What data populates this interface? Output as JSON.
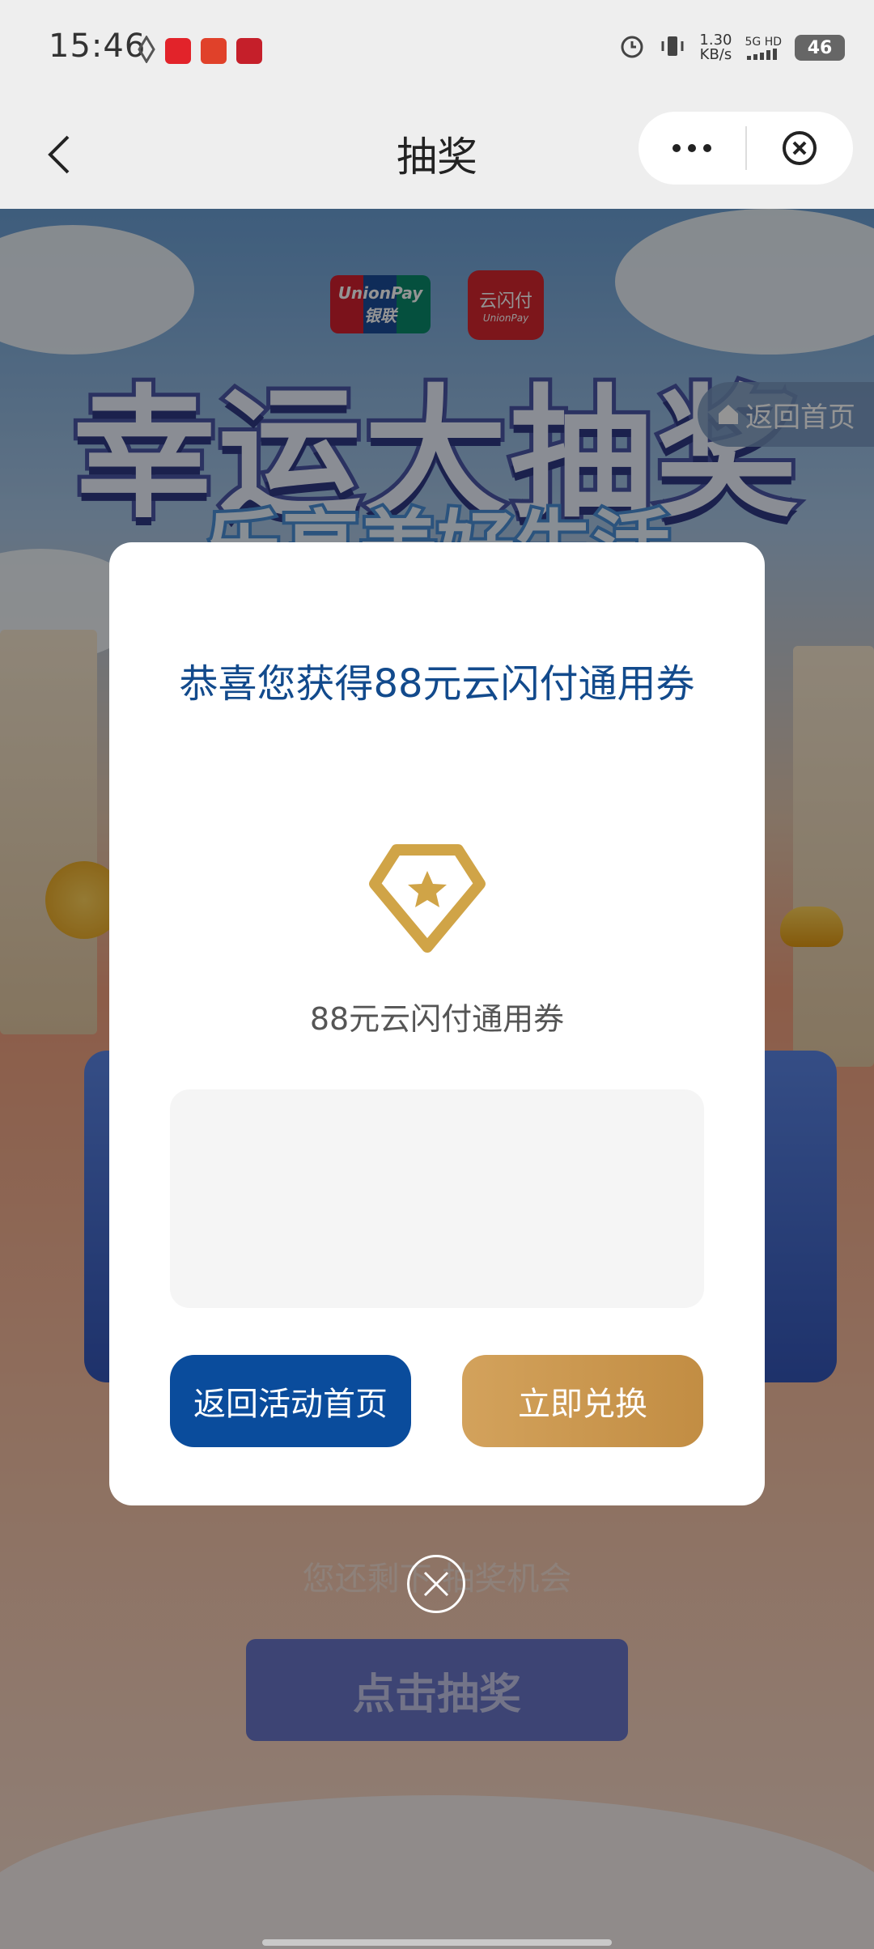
{
  "status_bar": {
    "time": "15:46",
    "net_speed_value": "1.30",
    "net_speed_unit": "KB/s",
    "signal_label": "5G HD",
    "battery": "46"
  },
  "header": {
    "title": "抽奖"
  },
  "background": {
    "unionpay_logo_en": "UnionPay",
    "unionpay_logo_cn": "银联",
    "yunshanfu_logo": "云闪付",
    "yunshanfu_logo_en": "UnionPay",
    "banner_title": "幸运大抽奖",
    "banner_subtitle": "乐享美好生活",
    "return_home_tab": "返回首页",
    "remaining_text": "您还剩下  抽奖机会",
    "draw_button": "点击抽奖"
  },
  "modal": {
    "title": "恭喜您获得88元云闪付通用券",
    "prize_name": "88元云闪付通用券",
    "back_button": "返回活动首页",
    "redeem_button": "立即兑换"
  },
  "colors": {
    "primary_blue": "#0a4c9c",
    "gold": "#c9974f",
    "title_blue": "#124a8c"
  }
}
